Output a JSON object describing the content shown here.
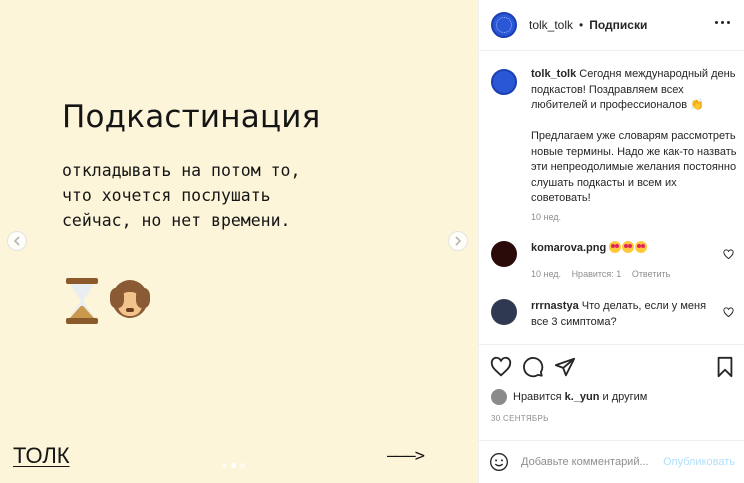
{
  "slide": {
    "title": "Подкастинация",
    "subtitle_lines": [
      "откладывать на потом то,",
      "что хочется послушать",
      "сейчас, но нет времени."
    ],
    "brand": "ТОЛК",
    "arrow": "———>",
    "emoji_icons": [
      "hourglass-icon",
      "see-no-evil-monkey-icon"
    ],
    "prev_icon": "chevron-left-icon",
    "next_icon": "chevron-right-icon",
    "dots_count": 3,
    "active_dot": 1
  },
  "header": {
    "username": "tolk_tolk",
    "separator": "•",
    "follow_label": "Подписки",
    "more_icon": "more-horizontal-icon"
  },
  "caption": {
    "username": "tolk_tolk",
    "paragraph1": "Сегодня международный день подкастов! Поздравляем всех любителей и профессионалов",
    "paragraph1_emoji": "👏",
    "paragraph2": "Предлагаем уже словарям рассмотреть новые термины. Надо же как-то назвать эти непреодолимые желания постоянно слушать подкасты и всем их советовать!",
    "age": "10 нед."
  },
  "comments": [
    {
      "username": "komarova.png",
      "text": "",
      "emoji_count": 3,
      "age": "10 нед.",
      "likes": "Нравится: 1",
      "reply_label": "Ответить",
      "avatar_color": "#2b0a0a"
    },
    {
      "username": "rrrnastya",
      "text": "Что делать, если у меня все 3 симптома?",
      "avatar_color": "#2f3a52"
    }
  ],
  "actions": {
    "like_icon": "heart-icon",
    "comment_icon": "comment-icon",
    "share_icon": "paper-plane-icon",
    "save_icon": "bookmark-icon"
  },
  "likes": {
    "prefix": "Нравится",
    "user": "k._yun",
    "suffix": "и другим"
  },
  "date": "30 СЕНТЯБРЬ",
  "add_comment": {
    "placeholder": "Добавьте комментарий...",
    "publish_label": "Опубликовать",
    "emoji_icon": "smiley-icon"
  },
  "colors": {
    "slide_bg": "#fcf5d9",
    "accent_blue": "#2a57d6",
    "publish_disabled": "#b2dffc",
    "muted": "#8e8e8e"
  }
}
